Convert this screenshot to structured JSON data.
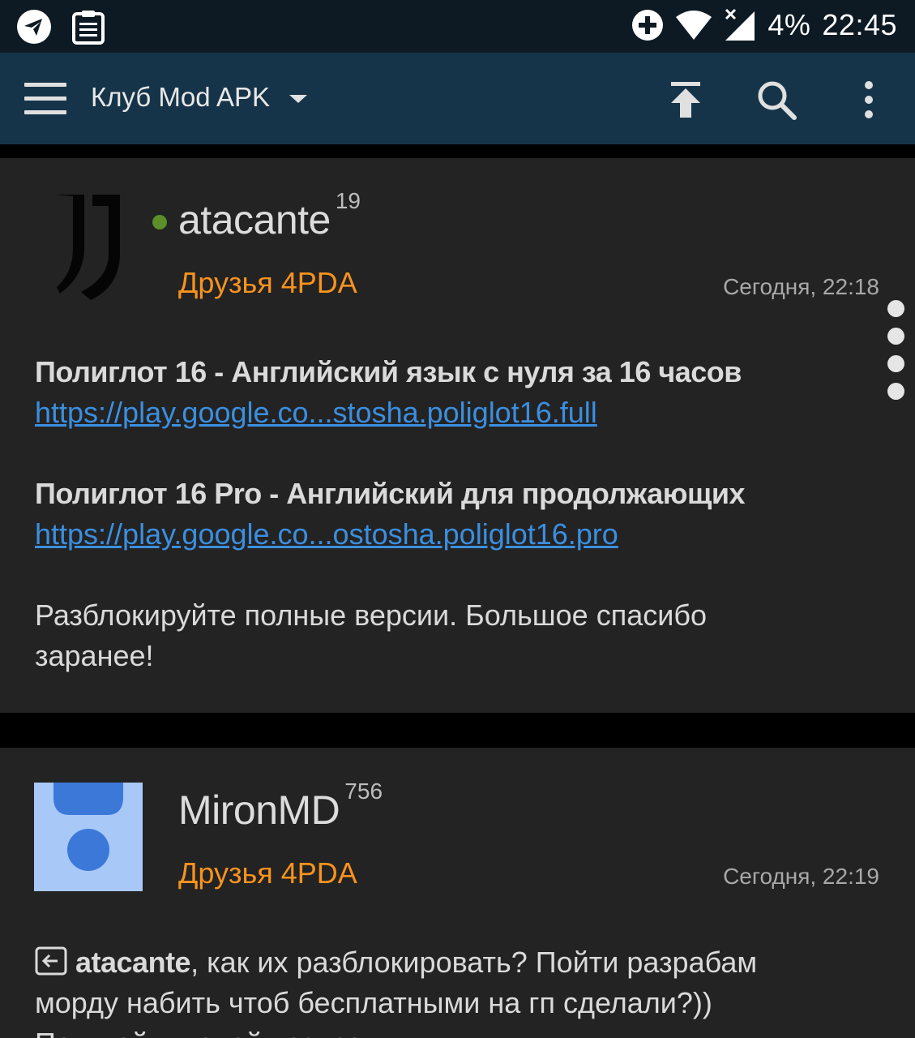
{
  "statusbar": {
    "battery": "4%",
    "time": "22:45"
  },
  "appbar": {
    "title": "Клуб Mod APK"
  },
  "posts": [
    {
      "username": "atacante",
      "reputation": "19",
      "group": "Друзья 4PDA",
      "date": "Сегодня, 22:18",
      "lines": [
        "Полиглот 16 - Английский язык с нуля за 16 часов",
        "https://play.google.co...stosha.poliglot16.full",
        "Полиглот 16 Pro - Английский для продолжающих",
        "https://play.google.co...ostosha.poliglot16.pro",
        "Разблокируйте полные версии. Большое спасибо",
        "заранее!"
      ]
    },
    {
      "username": "MironMD",
      "reputation": "756",
      "group": "Друзья 4PDA",
      "date": "Сегодня, 22:19",
      "quoted_user": "atacante",
      "lines": [
        ", как их разблокировать? Пойти разрабам",
        "морду набить чтоб бесплатными на гп сделали?))",
        "Покупай и делай возврат"
      ]
    }
  ],
  "colors": {
    "statusbar_bg": "#0d1a24",
    "appbar_bg": "#163449",
    "post_bg": "#232323",
    "group_orange": "#f7931e",
    "link_blue": "#3b8fe0",
    "online_green": "#5a8f29"
  },
  "icons": [
    "telegram-icon",
    "clipboard-icon",
    "add-circle-icon",
    "wifi-icon",
    "signal-icon",
    "menu-icon",
    "dropdown-arrow-icon",
    "scroll-to-top-icon",
    "search-icon",
    "more-vert-icon",
    "quote-icon"
  ]
}
